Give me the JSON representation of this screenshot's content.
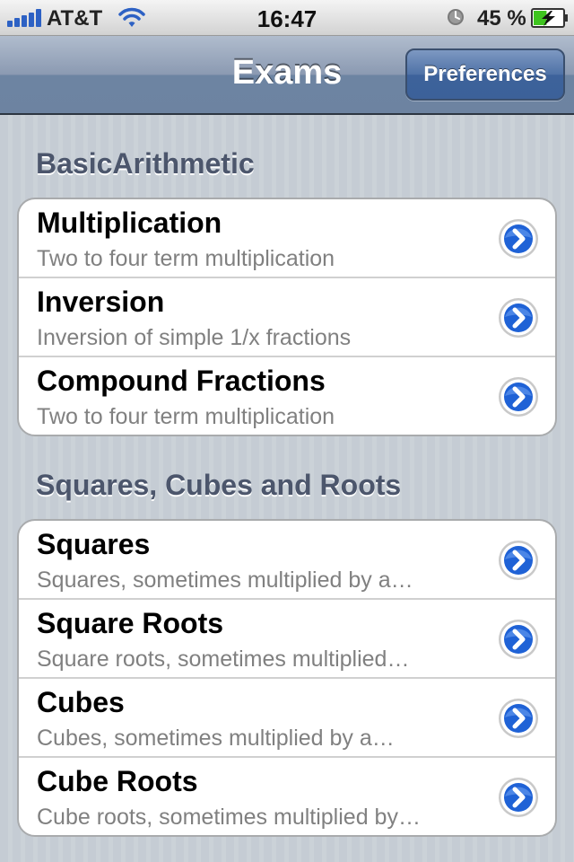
{
  "status_bar": {
    "carrier": "AT&T",
    "time": "16:47",
    "battery_percent": "45 %",
    "battery_level": 0.45,
    "signal_icon": "signal-bars-icon",
    "wifi_icon": "wifi-icon",
    "alarm_icon": "alarm-clock-icon",
    "battery_icon": "battery-charging-icon"
  },
  "nav_bar": {
    "title": "Exams",
    "right_button_label": "Preferences"
  },
  "sections": [
    {
      "header": "BasicArithmetic",
      "rows": [
        {
          "title": "Multiplication",
          "subtitle": "Two to four term multiplication"
        },
        {
          "title": "Inversion",
          "subtitle": "Inversion of simple 1/x fractions"
        },
        {
          "title": "Compound Fractions",
          "subtitle": "Two to four term multiplication"
        }
      ]
    },
    {
      "header": "Squares, Cubes and Roots",
      "rows": [
        {
          "title": "Squares",
          "subtitle": "Squares, sometimes multiplied by a…"
        },
        {
          "title": "Square Roots",
          "subtitle": "Square roots, sometimes multiplied…"
        },
        {
          "title": "Cubes",
          "subtitle": "Cubes, sometimes multiplied by a…"
        },
        {
          "title": "Cube Roots",
          "subtitle": "Cube roots, sometimes multiplied by…"
        }
      ]
    }
  ],
  "colors": {
    "nav_bar": "#6d84a2",
    "button": "#3d629b",
    "section_header": "#4c566c",
    "subtitle": "#808080",
    "disclosure": "#1f62d6"
  },
  "accessory_icon": "detail-disclosure-icon"
}
